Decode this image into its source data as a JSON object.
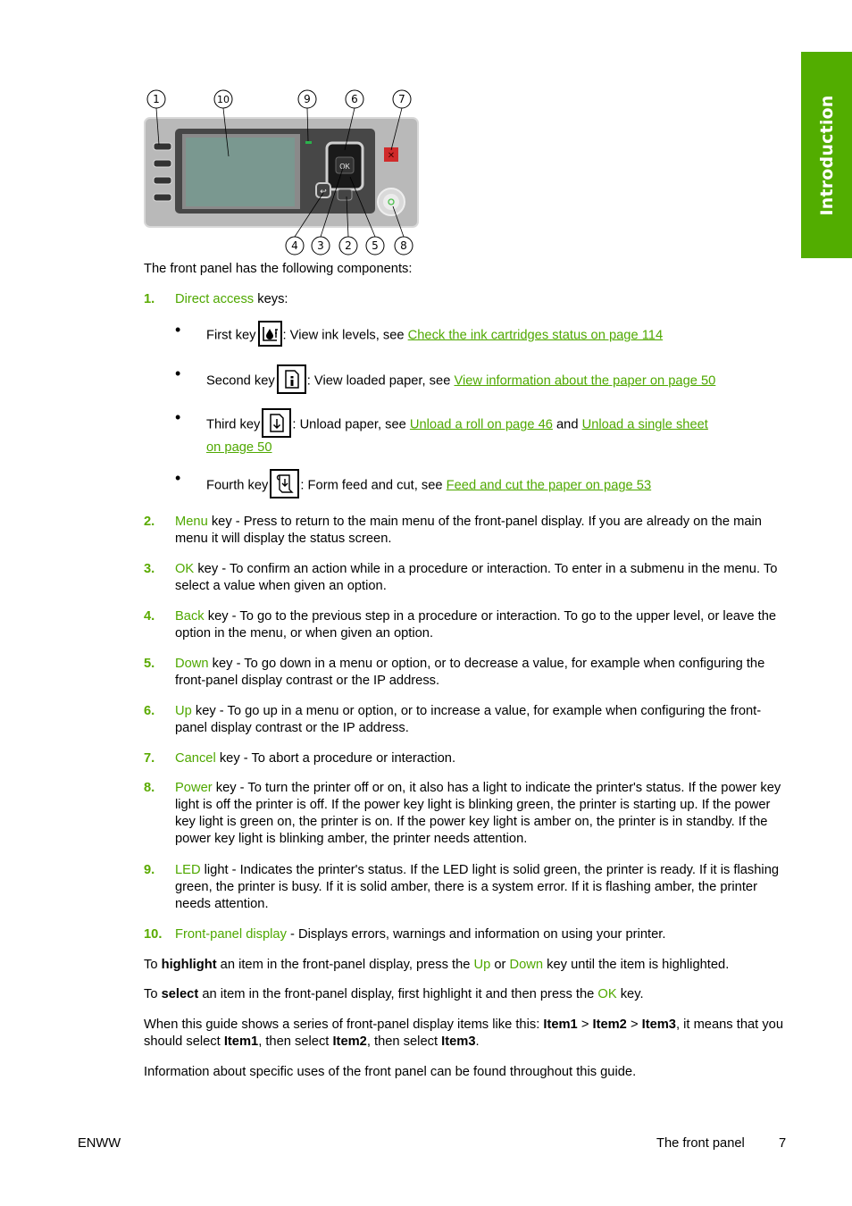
{
  "side_tab": {
    "label": "Introduction",
    "color": "#52ad00"
  },
  "figure": {
    "callouts_top": [
      "1",
      "10",
      "9",
      "6",
      "7"
    ],
    "callouts_bottom": [
      "4",
      "3",
      "2",
      "5",
      "8"
    ],
    "ok_label": "OK"
  },
  "intro": "The front panel has the following components:",
  "items": [
    {
      "n": "1.",
      "term": "Direct access",
      "rest": " keys:"
    },
    {
      "n": "2.",
      "term": "Menu",
      "rest": " key - Press to return to the main menu of the front-panel display. If you are already on the main menu it will display the status screen."
    },
    {
      "n": "3.",
      "term": "OK",
      "rest": " key - To confirm an action while in a procedure or interaction. To enter in a submenu in the menu. To select a value when given an option."
    },
    {
      "n": "4.",
      "term": "Back",
      "rest": " key - To go to the previous step in a procedure or interaction. To go to the upper level, or leave the option in the menu, or when given an option."
    },
    {
      "n": "5.",
      "term": "Down",
      "rest": " key - To go down in a menu or option, or to decrease a value, for example when configuring the front-panel display contrast or the IP address."
    },
    {
      "n": "6.",
      "term": "Up",
      "rest": " key - To go up in a menu or option, or to increase a value, for example when configuring the front-panel display contrast or the IP address."
    },
    {
      "n": "7.",
      "term": "Cancel",
      "rest": " key - To abort a procedure or interaction."
    },
    {
      "n": "8.",
      "term": "Power",
      "rest": " key - To turn the printer off or on, it also has a light to indicate the printer's status. If the power key light is off the printer is off. If the power key light is blinking green, the printer is starting up. If the power key light is green on, the printer is on. If the power key light is amber on, the printer is in standby. If the power key light is blinking amber, the printer needs attention."
    },
    {
      "n": "9.",
      "term": "LED",
      "rest": " light - Indicates the printer's status. If the LED light is solid green, the printer is ready. If it is flashing green, the printer is busy. If it is solid amber, there is a system error. If it is flashing amber, the printer needs attention."
    },
    {
      "n": "10.",
      "term": "Front-panel display",
      "rest": " - Displays errors, warnings and information on using your printer."
    }
  ],
  "direct_keys": [
    {
      "label": "First key",
      "icon": "ink-level-icon",
      "desc": ": View ink levels, see ",
      "link": "Check the ink cartridges status on page 114"
    },
    {
      "label": "Second key",
      "icon": "paper-info-icon",
      "desc": ": View loaded paper, see ",
      "link": "View information about the paper on page 50"
    },
    {
      "label": "Third key",
      "icon": "unload-paper-icon",
      "desc": ": Unload paper, see ",
      "link": "Unload a roll on page 46",
      "mid": " and ",
      "link2a": "Unload a single sheet",
      "link2b": "on page 50"
    },
    {
      "label": "Fourth key",
      "icon": "form-feed-cut-icon",
      "desc": ": Form feed and cut, see ",
      "link": "Feed and cut the paper on page 53"
    }
  ],
  "highlight_para": {
    "a": "To ",
    "b": "highlight",
    "c": " an item in the front-panel display, press the ",
    "up": "Up",
    "d": " or ",
    "down": "Down",
    "e": " key until the item is highlighted."
  },
  "select_para": {
    "a": "To ",
    "b": "select",
    "c": " an item in the front-panel display, first highlight it and then press the ",
    "ok": "OK",
    "d": " key."
  },
  "series_para": {
    "a": "When this guide shows a series of front-panel display items like this: ",
    "i1": "Item1",
    "gt1": " > ",
    "i2": "Item2",
    "gt2": " > ",
    "i3": "Item3",
    "b": ", it means that you should select ",
    "i1b": "Item1",
    "c": ", then select ",
    "i2b": "Item2",
    "d": ", then select ",
    "i3b": "Item3",
    "e": "."
  },
  "final_para": "Information about specific uses of the front panel can be found throughout this guide.",
  "footer": {
    "left": "ENWW",
    "section": "The front panel",
    "page": "7"
  }
}
